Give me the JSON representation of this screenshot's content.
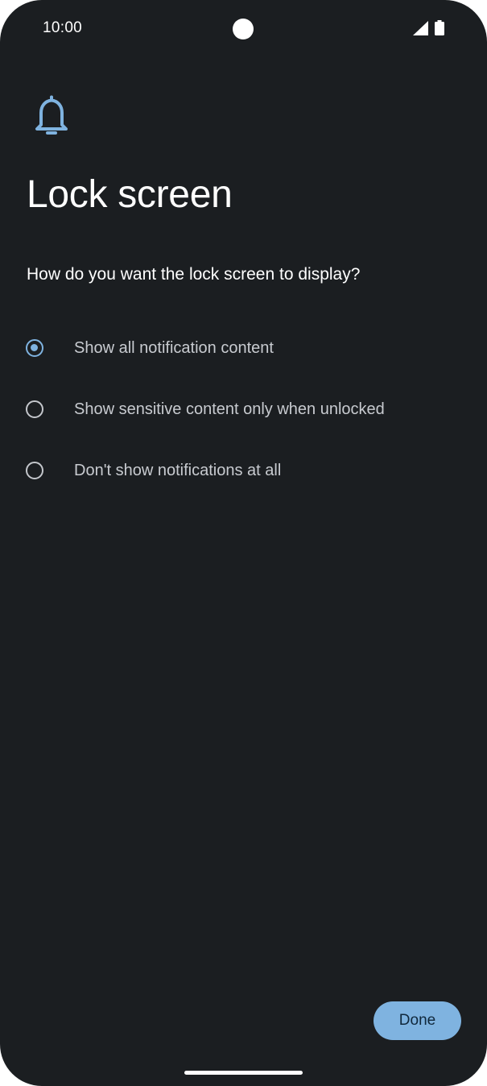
{
  "status_bar": {
    "time": "10:00",
    "icons": [
      "camera-cutout",
      "cellular-signal-icon",
      "battery-icon"
    ]
  },
  "header": {
    "icon": "bell-icon",
    "title": "Lock screen",
    "subtitle": "How do you want the lock screen to display?"
  },
  "options": [
    {
      "label": "Show all notification content",
      "selected": true
    },
    {
      "label": "Show sensitive content only when unlocked",
      "selected": false
    },
    {
      "label": "Don't show notifications at all",
      "selected": false
    }
  ],
  "footer": {
    "done_label": "Done"
  },
  "colors": {
    "background": "#1b1e21",
    "accent": "#7fb3e0",
    "on_accent": "#10283c",
    "text_primary": "#ffffff",
    "text_secondary": "#c8cbd0"
  }
}
